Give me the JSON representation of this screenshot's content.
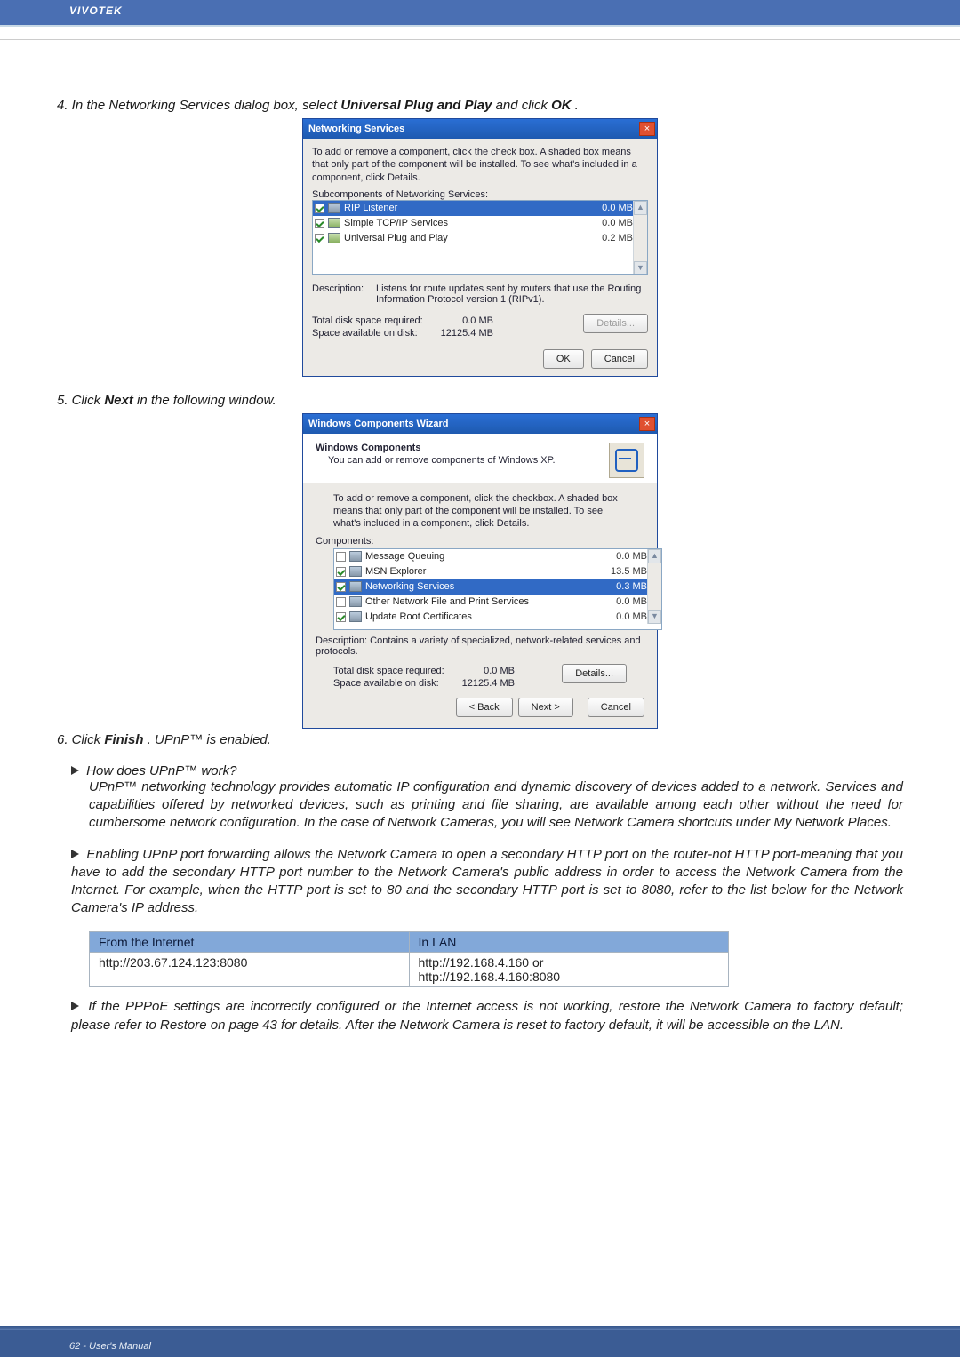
{
  "header": {
    "brand": "VIVOTEK"
  },
  "step4": {
    "prefix": "4. In the Networking Services dialog box, select ",
    "bold1": "Universal Plug and Play",
    "mid": " and click ",
    "bold2": "OK",
    "suffix": "."
  },
  "dlg1": {
    "title": "Networking Services",
    "intro": "To add or remove a component, click the check box. A shaded box means that only part of the component will be installed. To see what's included in a component, click Details.",
    "subhead": "Subcomponents of Networking Services:",
    "rows": [
      {
        "label": "RIP Listener",
        "size": "0.0 MB",
        "checked": true,
        "selected": true,
        "green": false
      },
      {
        "label": "Simple TCP/IP Services",
        "size": "0.0 MB",
        "checked": true,
        "selected": false,
        "green": true
      },
      {
        "label": "Universal Plug and Play",
        "size": "0.2 MB",
        "checked": true,
        "selected": false,
        "green": true
      }
    ],
    "desc_label": "Description:",
    "desc_value": "Listens for route updates sent by routers that use the Routing Information Protocol version 1 (RIPv1).",
    "req_total_l": "Total disk space required:",
    "req_total_v": "0.0 MB",
    "req_avail_l": "Space available on disk:",
    "req_avail_v": "12125.4 MB",
    "btn_details": "Details...",
    "btn_ok": "OK",
    "btn_cancel": "Cancel"
  },
  "step5": {
    "prefix": "5. Click ",
    "bold": "Next",
    "suffix": " in the following window."
  },
  "wiz": {
    "title": "Windows Components Wizard",
    "head": "Windows Components",
    "sub": "You can add or remove components of Windows XP.",
    "intro": "To add or remove a component, click the checkbox. A shaded box means that only part of the component will be installed. To see what's included in a component, click Details.",
    "components_label": "Components:",
    "rows": [
      {
        "label": "Message Queuing",
        "size": "0.0 MB",
        "checked": false,
        "selected": false
      },
      {
        "label": "MSN Explorer",
        "size": "13.5 MB",
        "checked": true,
        "selected": false
      },
      {
        "label": "Networking Services",
        "size": "0.3 MB",
        "checked": true,
        "selected": true
      },
      {
        "label": "Other Network File and Print Services",
        "size": "0.0 MB",
        "checked": false,
        "selected": false
      },
      {
        "label": "Update Root Certificates",
        "size": "0.0 MB",
        "checked": true,
        "selected": false
      }
    ],
    "desc": "Description:   Contains a variety of specialized, network-related services and protocols.",
    "req_total_l": "Total disk space required:",
    "req_total_v": "0.0 MB",
    "req_avail_l": "Space available on disk:",
    "req_avail_v": "12125.4 MB",
    "btn_details": "Details...",
    "btn_back": "< Back",
    "btn_next": "Next >",
    "btn_cancel": "Cancel"
  },
  "step6": {
    "prefix": "6. Click ",
    "bold": "Finish",
    "suffix": ". UPnP™ is enabled."
  },
  "q1": {
    "title": "How does UPnP™ work?",
    "body": "UPnP™ networking technology provides automatic IP configuration and dynamic discovery of devices added to a network. Services and capabilities offered by networked devices, such as printing and file sharing, are available among each other without the need for cumbersome network configuration. In the case of Network Cameras, you will see Network Camera shortcuts under My Network Places."
  },
  "q2": {
    "body": "Enabling UPnP port forwarding allows the Network Camera to open a secondary HTTP port on the router-not HTTP port-meaning that you have to add the secondary HTTP port number to the Network Camera's public address in order to access the Network Camera from the Internet. For example, when the HTTP port is set to 80 and the secondary HTTP port is set to 8080, refer to the list below for the Network Camera's IP address."
  },
  "table": {
    "h1": "From the Internet",
    "h2": "In LAN",
    "c1": "http://203.67.124.123:8080",
    "c2a": "http://192.168.4.160 or",
    "c2b": "http://192.168.4.160:8080"
  },
  "q3": {
    "body": "If the PPPoE settings are incorrectly configured or the Internet access is not working, restore the Network Camera to factory default; please refer to Restore on page 43 for details. After the Network Camera is reset to factory default, it will be accessible on the LAN."
  },
  "footer": {
    "text": "62 - User's Manual"
  }
}
